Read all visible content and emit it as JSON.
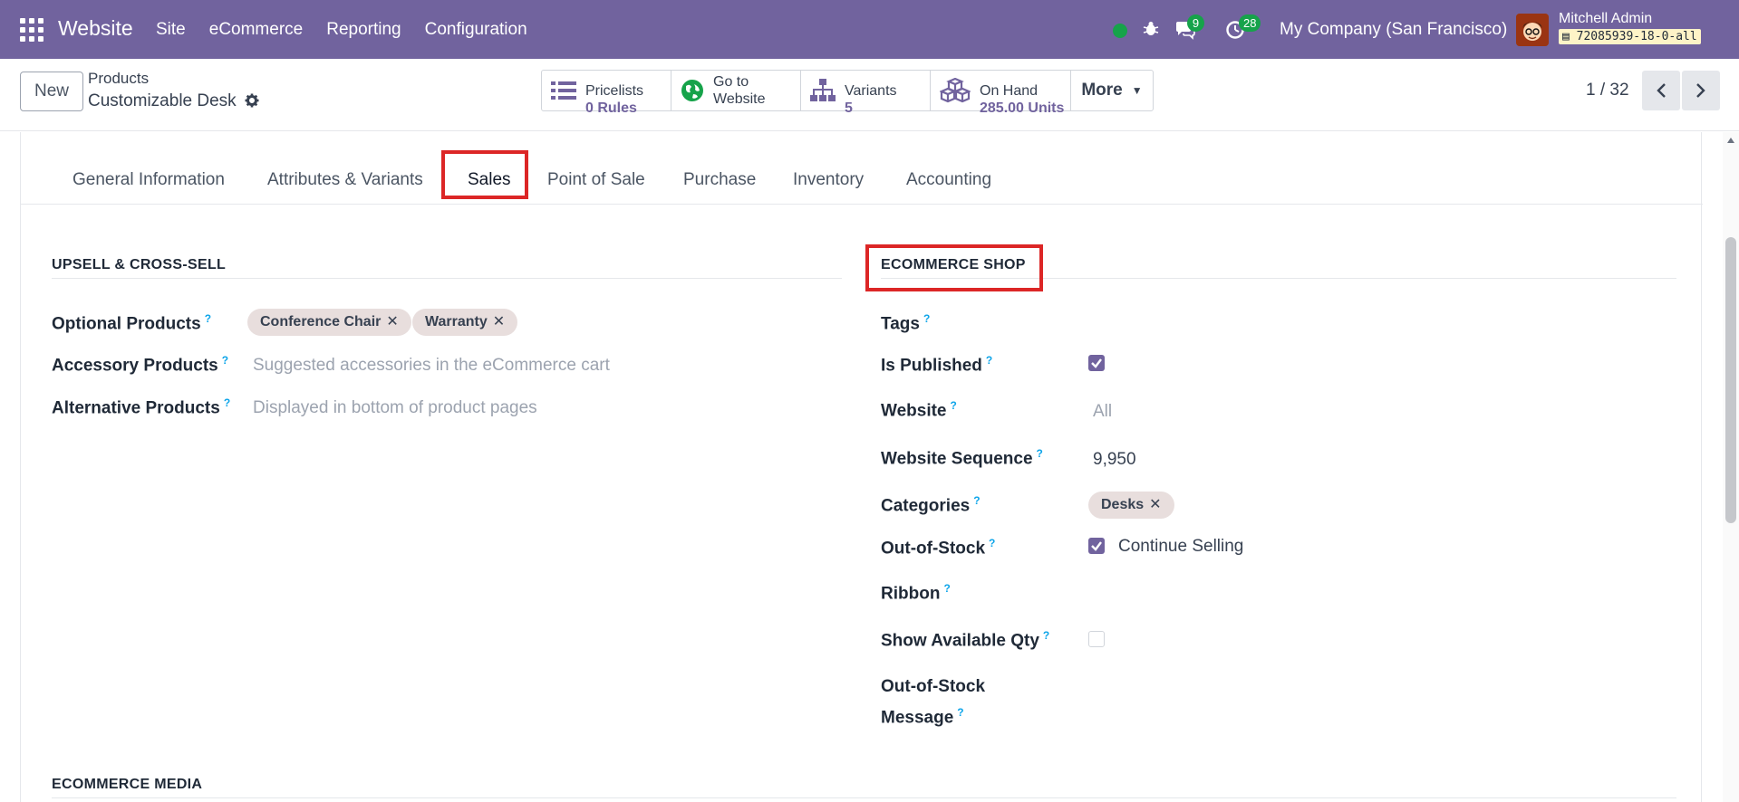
{
  "navbar": {
    "brand": "Website",
    "menu": [
      "Site",
      "eCommerce",
      "Reporting",
      "Configuration"
    ],
    "messages_badge": "9",
    "activities_badge": "28",
    "company": "My Company (San Francisco)",
    "user_name": "Mitchell Admin",
    "db_tag": "72085939-18-0-all",
    "accent": "#71639e",
    "status_color": "#16a34a"
  },
  "control": {
    "new_label": "New",
    "breadcrumb_parent": "Products",
    "breadcrumb_current": "Customizable Desk",
    "smart_buttons": [
      {
        "icon": "list-icon",
        "label": "Pricelists",
        "value": "0 Rules"
      },
      {
        "icon": "globe-icon",
        "label": "Go to",
        "value": "Website"
      },
      {
        "icon": "sitemap-icon",
        "label": "Variants",
        "value": "5"
      },
      {
        "icon": "cubes-icon",
        "label": "On Hand",
        "value": "285.00 Units"
      }
    ],
    "more_label": "More",
    "pager": "1 / 32"
  },
  "tabs": [
    "General Information",
    "Attributes & Variants",
    "Sales",
    "Point of Sale",
    "Purchase",
    "Inventory",
    "Accounting"
  ],
  "active_tab": "Sales",
  "upsell": {
    "title": "UPSELL & CROSS-SELL",
    "optional_label": "Optional Products",
    "optional_tags": [
      "Conference Chair",
      "Warranty"
    ],
    "accessory_label": "Accessory Products",
    "accessory_placeholder": "Suggested accessories in the eCommerce cart",
    "alternative_label": "Alternative Products",
    "alternative_placeholder": "Displayed in bottom of product pages"
  },
  "ecommerce": {
    "title": "ECOMMERCE SHOP",
    "tags_label": "Tags",
    "published_label": "Is Published",
    "published": true,
    "website_label": "Website",
    "website_placeholder": "All",
    "sequence_label": "Website Sequence",
    "sequence_value": "9,950",
    "categories_label": "Categories",
    "categories_tags": [
      "Desks"
    ],
    "oos_label": "Out-of-Stock",
    "oos_checked": true,
    "oos_value": "Continue Selling",
    "ribbon_label": "Ribbon",
    "show_qty_label": "Show Available Qty",
    "show_qty_checked": false,
    "oos_message_label_1": "Out-of-Stock",
    "oos_message_label_2": "Message"
  },
  "media": {
    "title": "ECOMMERCE MEDIA"
  }
}
